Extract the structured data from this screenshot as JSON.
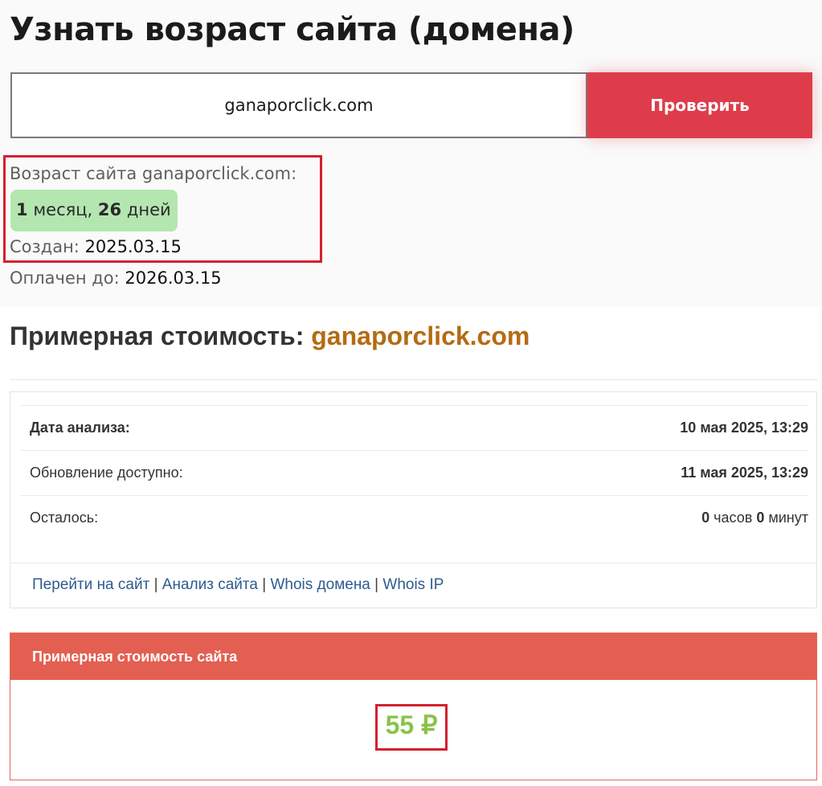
{
  "page": {
    "title": "Узнать возраст сайта (домена)"
  },
  "search": {
    "value": "ganaporclick.com",
    "button_label": "Проверить"
  },
  "age": {
    "label": "Возраст сайта ganaporclick.com:",
    "months_num": "1",
    "months_word": "месяц,",
    "days_num": "26",
    "days_word": "дней",
    "created_label": "Создан:",
    "created_value": "2025.03.15",
    "paid_label": "Оплачен до:",
    "paid_value": "2026.03.15"
  },
  "cost": {
    "heading_prefix": "Примерная стоимость:",
    "domain": "ganaporclick.com"
  },
  "analysis": {
    "rows": [
      {
        "label": "Дата анализа:",
        "value": "10 мая 2025, 13:29"
      },
      {
        "label": "Обновление доступно:",
        "value": "11 мая 2025, 13:29"
      },
      {
        "label": "Осталось:",
        "hours_num": "0",
        "hours_unit": "часов",
        "minutes_num": "0",
        "minutes_unit": "минут"
      }
    ],
    "links": [
      {
        "label": "Перейти на сайт"
      },
      {
        "label": "Анализ сайта"
      },
      {
        "label": "Whois домена"
      },
      {
        "label": "Whois IP"
      }
    ],
    "separator": "|"
  },
  "price": {
    "title": "Примерная стоимость сайта",
    "value": "55 ₽"
  },
  "colors": {
    "button": "#df3c4b",
    "highlight_border": "#d3212f",
    "age_pill": "#b4e6b0",
    "domain_accent": "#b56b12",
    "price_header": "#e35f52",
    "price_value": "#8bc34a",
    "link": "#2f5b8f"
  }
}
